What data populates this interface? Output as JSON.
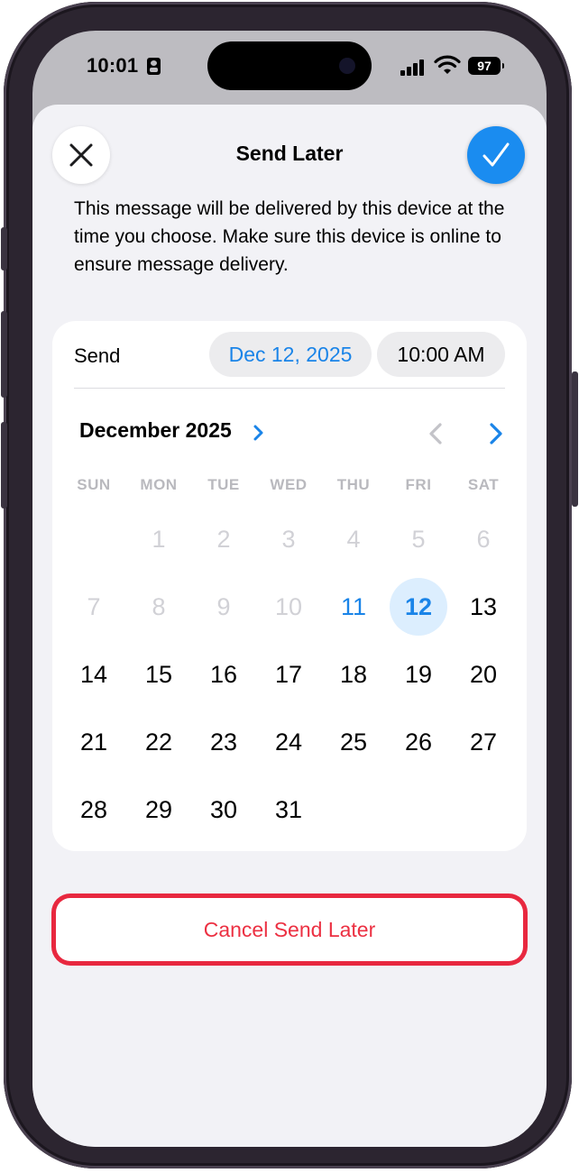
{
  "status_bar": {
    "time": "10:01",
    "battery": "97"
  },
  "header": {
    "title": "Send Later",
    "close_icon": "close-icon",
    "confirm_icon": "checkmark-icon"
  },
  "description": "This message will be delivered by this device at the time you choose. Make sure this device is online to ensure message delivery.",
  "schedule": {
    "send_label": "Send",
    "date": "Dec 12, 2025",
    "time": "10:00 AM"
  },
  "calendar": {
    "month_label": "December 2025",
    "weekdays": [
      "SUN",
      "MON",
      "TUE",
      "WED",
      "THU",
      "FRI",
      "SAT"
    ],
    "first_weekday_index": 1,
    "days_in_month": 31,
    "today": 11,
    "selected": 12
  },
  "actions": {
    "cancel_label": "Cancel Send Later"
  },
  "colors": {
    "accent": "#1a84e8",
    "destructive": "#ec3042",
    "highlight_border": "#e8283f"
  }
}
